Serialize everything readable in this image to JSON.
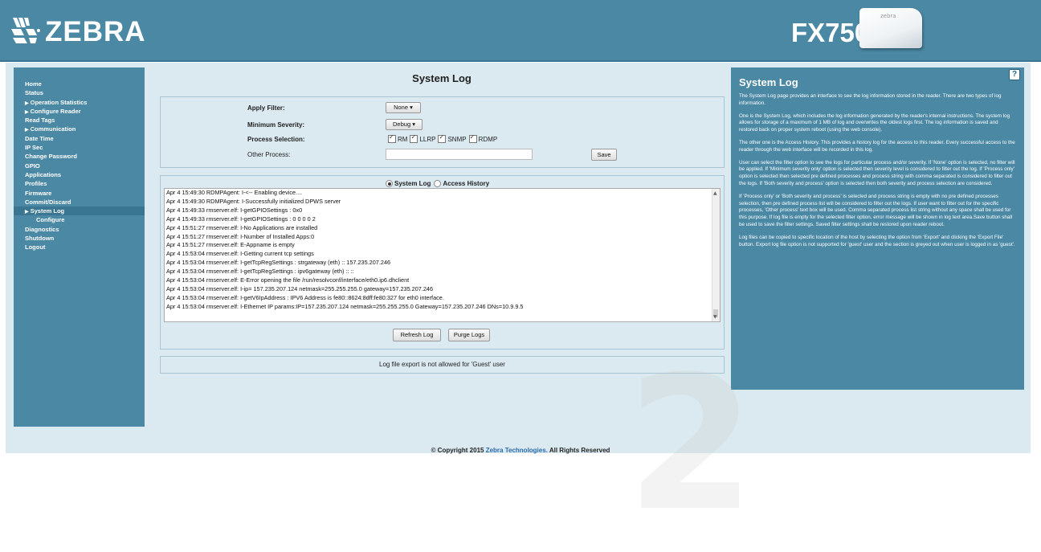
{
  "header": {
    "brand": "ZEBRA",
    "product": "FX7500",
    "device_label": "zebra"
  },
  "sidebar": {
    "items": [
      {
        "label": "Home"
      },
      {
        "label": "Status"
      },
      {
        "label": "Operation Statistics",
        "expandable": true
      },
      {
        "label": "Configure Reader",
        "expandable": true
      },
      {
        "label": "Read Tags"
      },
      {
        "label": "Communication",
        "expandable": true
      },
      {
        "label": "Date Time"
      },
      {
        "label": "IP Sec"
      },
      {
        "label": "Change Password"
      },
      {
        "label": "GPIO"
      },
      {
        "label": "Applications"
      },
      {
        "label": "Profiles"
      },
      {
        "label": "Firmware"
      },
      {
        "label": "Commit/Discard"
      },
      {
        "label": "System Log",
        "expandable": true,
        "active": true
      },
      {
        "label": "Configure",
        "sub": true
      },
      {
        "label": "Diagnostics"
      },
      {
        "label": "Shutdown"
      },
      {
        "label": "Logout"
      }
    ]
  },
  "page": {
    "title": "System Log"
  },
  "filter": {
    "apply_filter_label": "Apply Filter:",
    "apply_filter_value": "None",
    "min_severity_label": "Minimum Severity:",
    "min_severity_value": "Debug",
    "process_selection_label": "Process Selection:",
    "processes": [
      "RM",
      "LLRP",
      "SNMP",
      "RDMP"
    ],
    "other_process_label": "Other Process:",
    "other_process_value": "",
    "save_label": "Save"
  },
  "log": {
    "tabs": [
      "System Log",
      "Access History"
    ],
    "selected_tab": "System Log",
    "lines": [
      "Apr  4 15:49:30 RDMPAgent: I-<-- Enabling device....",
      "Apr  4 15:49:30 RDMPAgent: I-Successfully initialized DPWS server",
      "Apr  4 15:49:33 rmserver.elf: I-getGPIOSettings : 0x0",
      "Apr  4 15:49:33 rmserver.elf: I-getGPIOSettings : 0 0 0 0 2",
      "Apr  4 15:51:27 rmserver.elf: I-No Applications are installed",
      "Apr  4 15:51:27 rmserver.elf: I-Number of Installed Apps:0",
      "Apr  4 15:51:27 rmserver.elf: E-Appname is empty",
      "Apr  4 15:53:04 rmserver.elf: I-Getting current tcp settings",
      "Apr  4 15:53:04 rmserver.elf: I-getTcpRegSettings : strgateway (eth) :: 157.235.207.246",
      "Apr  4 15:53:04 rmserver.elf: I-getTcpRegSettings : ipv6gateway (eth) :: ::",
      "Apr  4 15:53:04 rmserver.elf: E-Error opening the file /run/resolvconf/interface/eth0.ip6.dhclient",
      "Apr  4 15:53:04 rmserver.elf: I-ip= 157.235.207.124  netmask=255.255.255.0  gateway=157.235.207.246",
      "Apr  4 15:53:04 rmserver.elf: I-getV6IpAddress : IPV6 Address is fe80::8624:8dff:fe80:327 for eth0 interface.",
      "Apr  4 15:53:04 rmserver.elf: I-Ethernet IP params:IP=157.235.207.124  netmask=255.255.255.0  Gateway=157.235.207.246  DNs=10.9.9.5"
    ],
    "refresh_label": "Refresh Log",
    "purge_label": "Purge Logs"
  },
  "export": {
    "message": "Log file export is not allowed for 'Guest' user"
  },
  "help": {
    "title": "System Log",
    "icon_label": "?",
    "paragraphs": [
      "The System Log page provides an interface to see the log information stored in the reader. There are two types of log information.",
      "One is the System Log, which includes the log information generated by the reader's internal instructions. The system log allows for storage of a maximum of 1 MB of log and overwrites the oldest logs first. The log information is saved and restored back on proper system reboot (using the web console).",
      "The other one is the Access History. This provides a history log for the access to this reader. Every successful access to the reader through the web interface will be recorded in this log.",
      "User can select the filter option to see the logs for particular process and/or severity. If 'None' option is selected, no filter will be applied. If 'Minimum severity only' option is selected then severity level is considered to filter out the log. If 'Process only' option is selected then selected pre defined processes and process string with comma separated is considered to filter out the logs. If 'Both severity and process' option is selected then both severity and process selection are considered.",
      "If 'Process only' or 'Both severity and process' is selected and process string is empty with no pre defined processes selection, then pre defined process list will be considered to filter out the logs. If user want to filter out for the specific processes, 'Other process' text box will be used. Comma separated process list string without any space shall be used for this purpose. If log file is empty for the selected filter option, error message will be shown in log text area.Save button shall be used to save the filter settings. Saved filter settings shall be restored upon reader reboot.",
      "Log files can be copied to specific location of the host by selecting the option from 'Export' and clicking the 'Export File' button. Export log file option is not supported for 'guest' user and the section is greyed out when user is logged in as 'guest'."
    ]
  },
  "footer": {
    "prefix": "© Copyright 2015 ",
    "link": "Zebra Technologies.",
    "suffix": " All Rights Reserved"
  },
  "watermark": "2"
}
